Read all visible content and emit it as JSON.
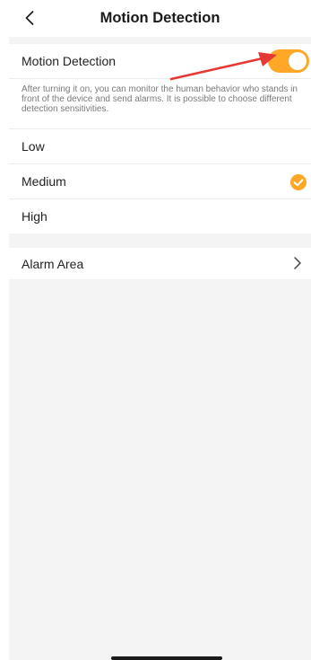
{
  "header": {
    "title": "Motion Detection"
  },
  "motion": {
    "label": "Motion Detection",
    "enabled": true,
    "description": "After turning it on, you can monitor the human behavior who stands in front of the device and send alarms. It is possible to choose different detection sensitivities."
  },
  "sensitivity": {
    "options": [
      "Low",
      "Medium",
      "High"
    ],
    "selected": "Medium"
  },
  "alarm_area": {
    "label": "Alarm Area"
  },
  "colors": {
    "accent": "#ffa726",
    "annotation_arrow": "#e53935",
    "background": "#f4f4f4"
  },
  "icons": {
    "back": "chevron-left-icon",
    "check": "check-circle-icon",
    "forward": "chevron-right-icon"
  }
}
